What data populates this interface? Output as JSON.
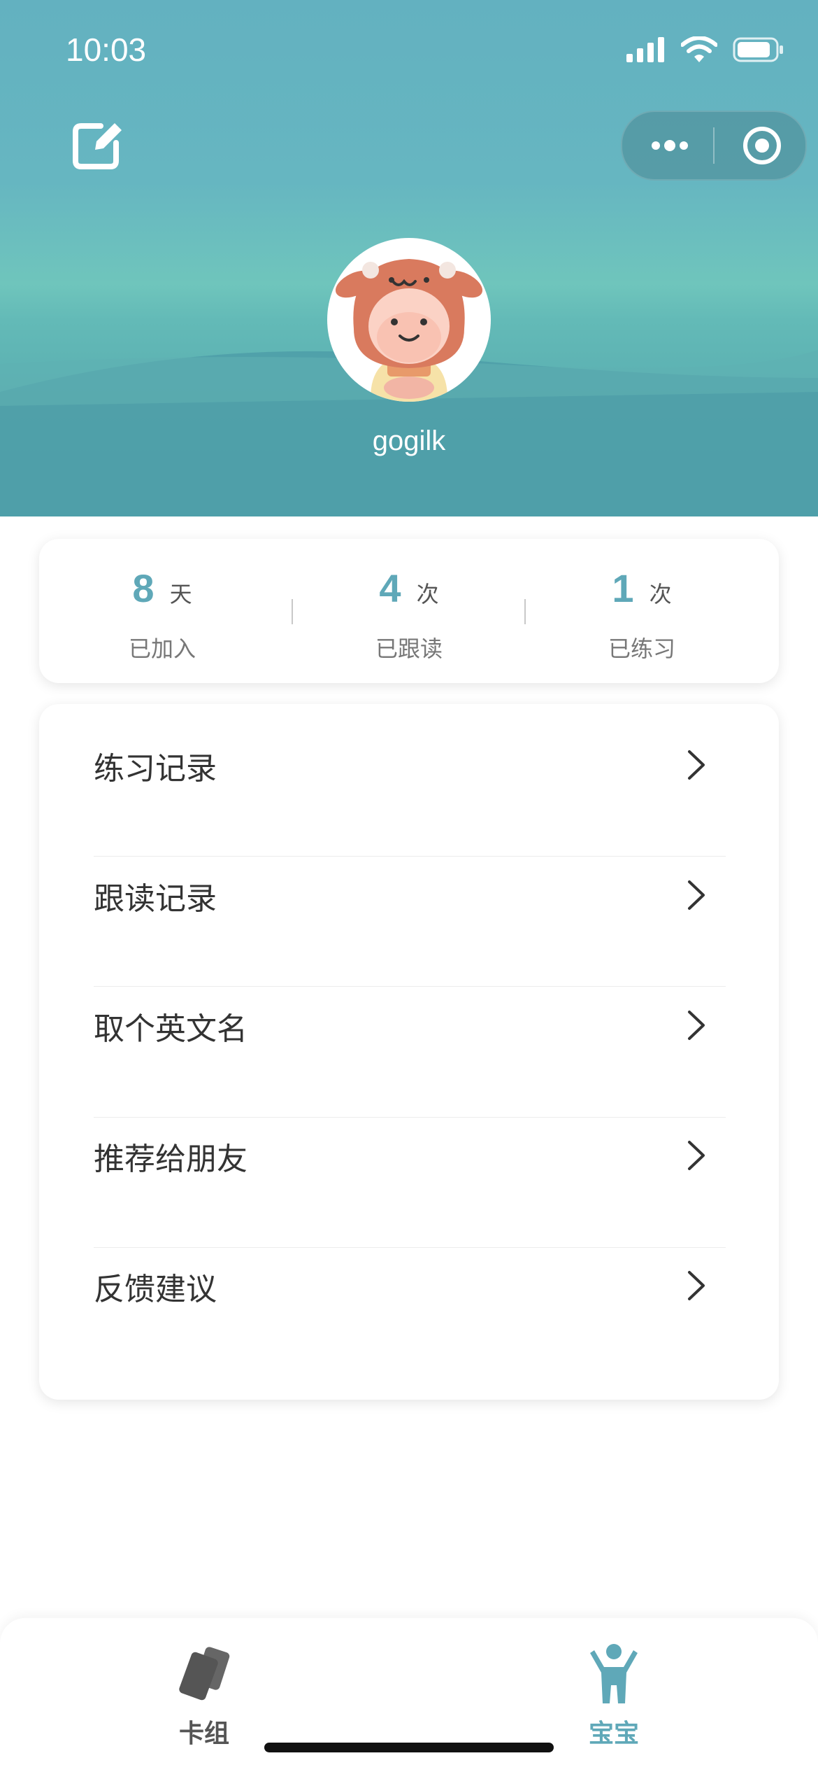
{
  "status_bar": {
    "time": "10:03"
  },
  "profile": {
    "username": "gogilk"
  },
  "stats": [
    {
      "value": "8",
      "unit": "天",
      "label": "已加入"
    },
    {
      "value": "4",
      "unit": "次",
      "label": "已跟读"
    },
    {
      "value": "1",
      "unit": "次",
      "label": "已练习"
    }
  ],
  "menu": [
    {
      "label": "练习记录"
    },
    {
      "label": "跟读记录"
    },
    {
      "label": "取个英文名"
    },
    {
      "label": "推荐给朋友"
    },
    {
      "label": "反馈建议"
    }
  ],
  "tabs": [
    {
      "label": "卡组",
      "icon": "cards-icon",
      "active": false
    },
    {
      "label": "宝宝",
      "icon": "child-icon",
      "active": true
    }
  ],
  "colors": {
    "accent": "#5fa8b8",
    "header_top": "#63b1c0",
    "header_bottom": "#4e9ea8",
    "tab_inactive": "#555555"
  }
}
